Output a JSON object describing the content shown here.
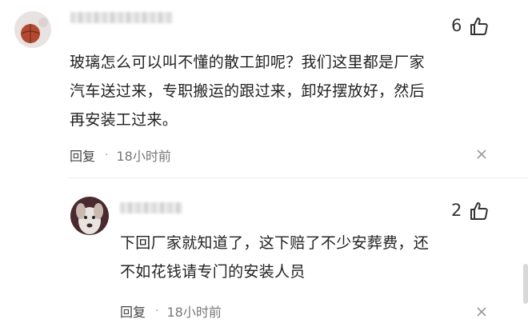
{
  "comments": [
    {
      "user_name": "",
      "like_count": "6",
      "text_lines": [
        "玻璃怎么可以叫不懂的散工卸呢？我们这里都是厂家",
        "汽车送过来，专职搬运的跟过来，卸好摆放好，然后",
        "再安装工过来。"
      ],
      "reply_label": "回复",
      "separator": "·",
      "timestamp": "18小时前"
    },
    {
      "user_name": "",
      "like_count": "2",
      "text_lines": [
        "下回厂家就知道了，这下赔了不少安葬费，还",
        "不如花钱请专门的安装人员"
      ],
      "reply_label": "回复",
      "separator": "·",
      "timestamp": "18小时前"
    }
  ],
  "icons": {
    "like": "thumbs-up-icon",
    "close": "close-icon"
  }
}
